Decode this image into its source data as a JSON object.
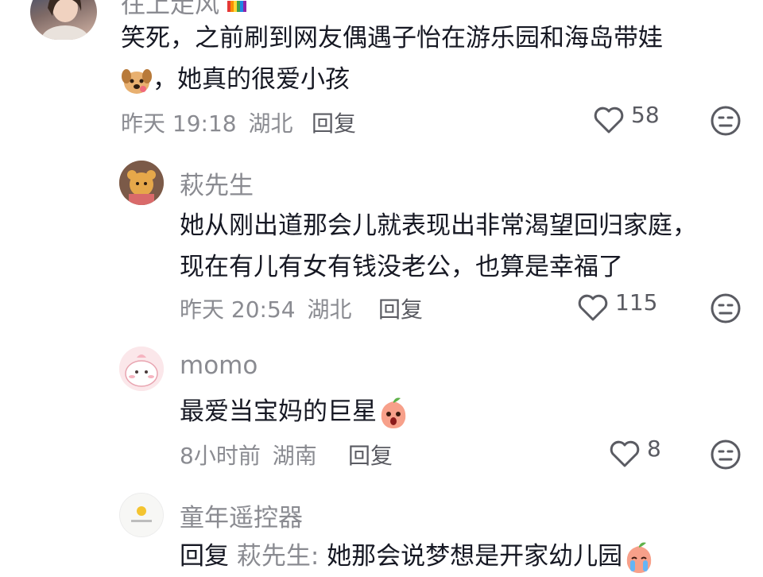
{
  "comments": [
    {
      "username": "往上走风",
      "text_line1": "笑死，之前刷到网友偶遇子怡在游乐园和海岛带娃",
      "text_line2": "，她真的很爱小孩",
      "time": "昨天 19:18",
      "location": "湖北",
      "reply_label": "回复",
      "likes": "58"
    },
    {
      "username": "萩先生",
      "text_line1": "她从刚出道那会儿就表现出非常渴望回归家庭，",
      "text_line2": "现在有儿有女有钱没老公，也算是幸福了",
      "time": "昨天 20:54",
      "location": "湖北",
      "reply_label": "回复",
      "likes": "115"
    },
    {
      "username": "momo",
      "text_line1": "最爱当宝妈的巨星",
      "time": "8小时前",
      "location": "湖南",
      "reply_label": "回复",
      "likes": "8"
    },
    {
      "username": "童年遥控器",
      "reply_prefix": "回复",
      "reply_to": "萩先生:",
      "text_line1": "她那会说梦想是开家幼儿园"
    }
  ],
  "colors": {
    "text": "#161823",
    "secondary": "#8a8b91",
    "action": "#5a5b62"
  },
  "icons": [
    "heart-icon",
    "dislike-face-icon",
    "rainbow-badge-icon",
    "puppy-emoji-icon",
    "peach-emoji-icon",
    "crying-emoji-icon"
  ]
}
